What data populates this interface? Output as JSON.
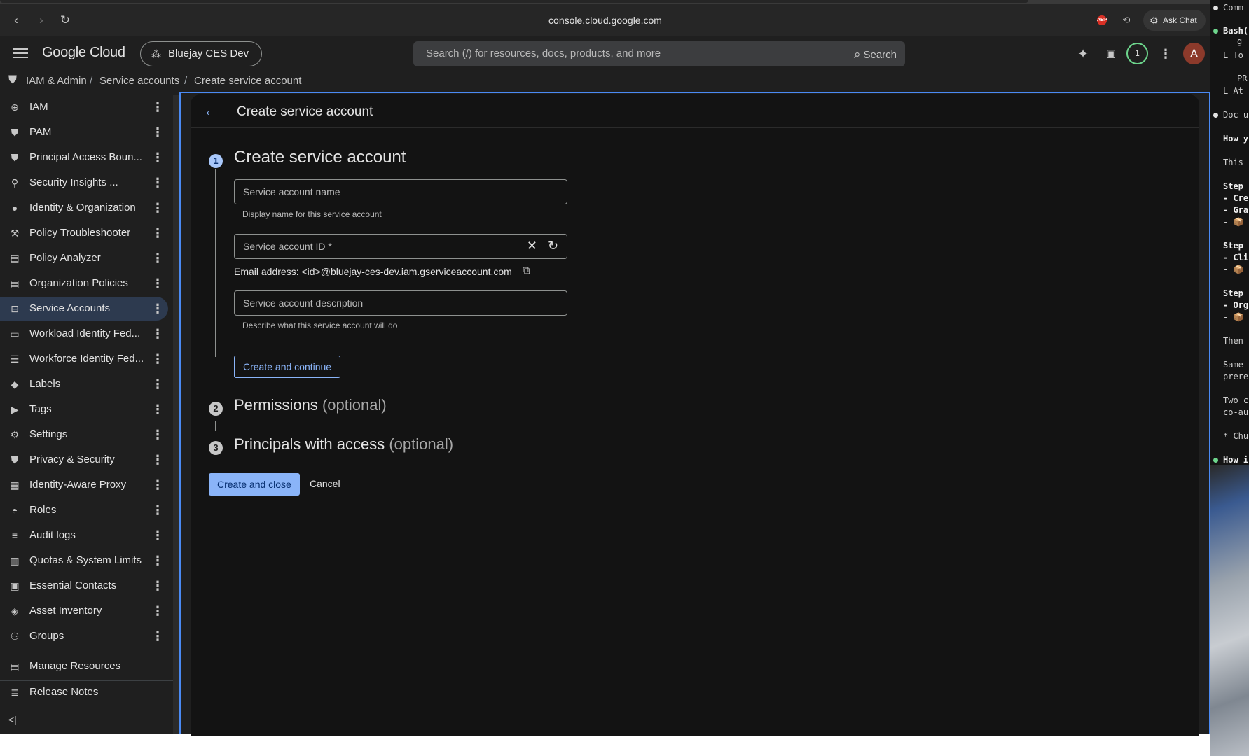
{
  "browser": {
    "url": "console.cloud.google.com",
    "ask_chat": "Ask Chat",
    "ext_badge": "ABP"
  },
  "header": {
    "logo": "Google Cloud",
    "project": "Bluejay CES Dev",
    "search_placeholder": "Search (/) for resources, docs, products, and more",
    "search_button": "Search",
    "notification_count": "1",
    "avatar_letter": "A"
  },
  "breadcrumb": [
    "IAM & Admin",
    "Service accounts",
    "Create service account"
  ],
  "sidebar": {
    "items": [
      {
        "label": "IAM",
        "icon": "person-add-icon"
      },
      {
        "label": "PAM",
        "icon": "shield-icon"
      },
      {
        "label": "Principal Access Boun...",
        "icon": "shield-search-icon"
      },
      {
        "label": "Security Insights ...",
        "icon": "person-search-icon"
      },
      {
        "label": "Identity & Organization",
        "icon": "account-circle-icon"
      },
      {
        "label": "Policy Troubleshooter",
        "icon": "wrench-icon"
      },
      {
        "label": "Policy Analyzer",
        "icon": "document-search-icon"
      },
      {
        "label": "Organization Policies",
        "icon": "document-list-icon"
      },
      {
        "label": "Service Accounts",
        "icon": "service-account-icon",
        "active": true
      },
      {
        "label": "Workload Identity Fed...",
        "icon": "id-card-icon"
      },
      {
        "label": "Workforce Identity Fed...",
        "icon": "list-icon"
      },
      {
        "label": "Labels",
        "icon": "tag-icon"
      },
      {
        "label": "Tags",
        "icon": "label-arrow-icon"
      },
      {
        "label": "Settings",
        "icon": "gear-icon"
      },
      {
        "label": "Privacy & Security",
        "icon": "shield-check-icon"
      },
      {
        "label": "Identity-Aware Proxy",
        "icon": "proxy-icon"
      },
      {
        "label": "Roles",
        "icon": "hat-icon"
      },
      {
        "label": "Audit logs",
        "icon": "lines-icon"
      },
      {
        "label": "Quotas & System Limits",
        "icon": "quota-icon"
      },
      {
        "label": "Essential Contacts",
        "icon": "contacts-icon"
      },
      {
        "label": "Asset Inventory",
        "icon": "layers-icon"
      },
      {
        "label": "Groups",
        "icon": "group-icon"
      }
    ],
    "manage_resources": "Manage Resources",
    "release_notes": "Release Notes"
  },
  "page": {
    "title": "Create service account",
    "step1": {
      "number": "1",
      "title": "Create service account",
      "name_placeholder": "Service account name",
      "name_hint": "Display name for this service account",
      "id_placeholder": "Service account ID *",
      "email": "Email address: <id>@bluejay-ces-dev.iam.gserviceaccount.com",
      "description_placeholder": "Service account description",
      "description_hint": "Describe what this service account will do",
      "continue_button": "Create and continue"
    },
    "step2": {
      "number": "2",
      "title": "Permissions",
      "optional": "(optional)"
    },
    "step3": {
      "number": "3",
      "title": "Principals with access",
      "optional": "(optional)"
    },
    "create_close_button": "Create and close",
    "cancel_button": "Cancel"
  },
  "terminal": {
    "lines": [
      "Comm",
      "Bash(",
      "g",
      "L To",
      "PR",
      "L At",
      "Doc u",
      "How y",
      "This",
      "Step",
      "- Cre",
      "- Gra",
      "- 📦",
      "Step",
      "- Cli",
      "- 📦",
      "Step",
      "- Org",
      "- 📦",
      "Then",
      "Same",
      "prere",
      "Two c",
      "co-au",
      "* Churn",
      "How i"
    ]
  }
}
